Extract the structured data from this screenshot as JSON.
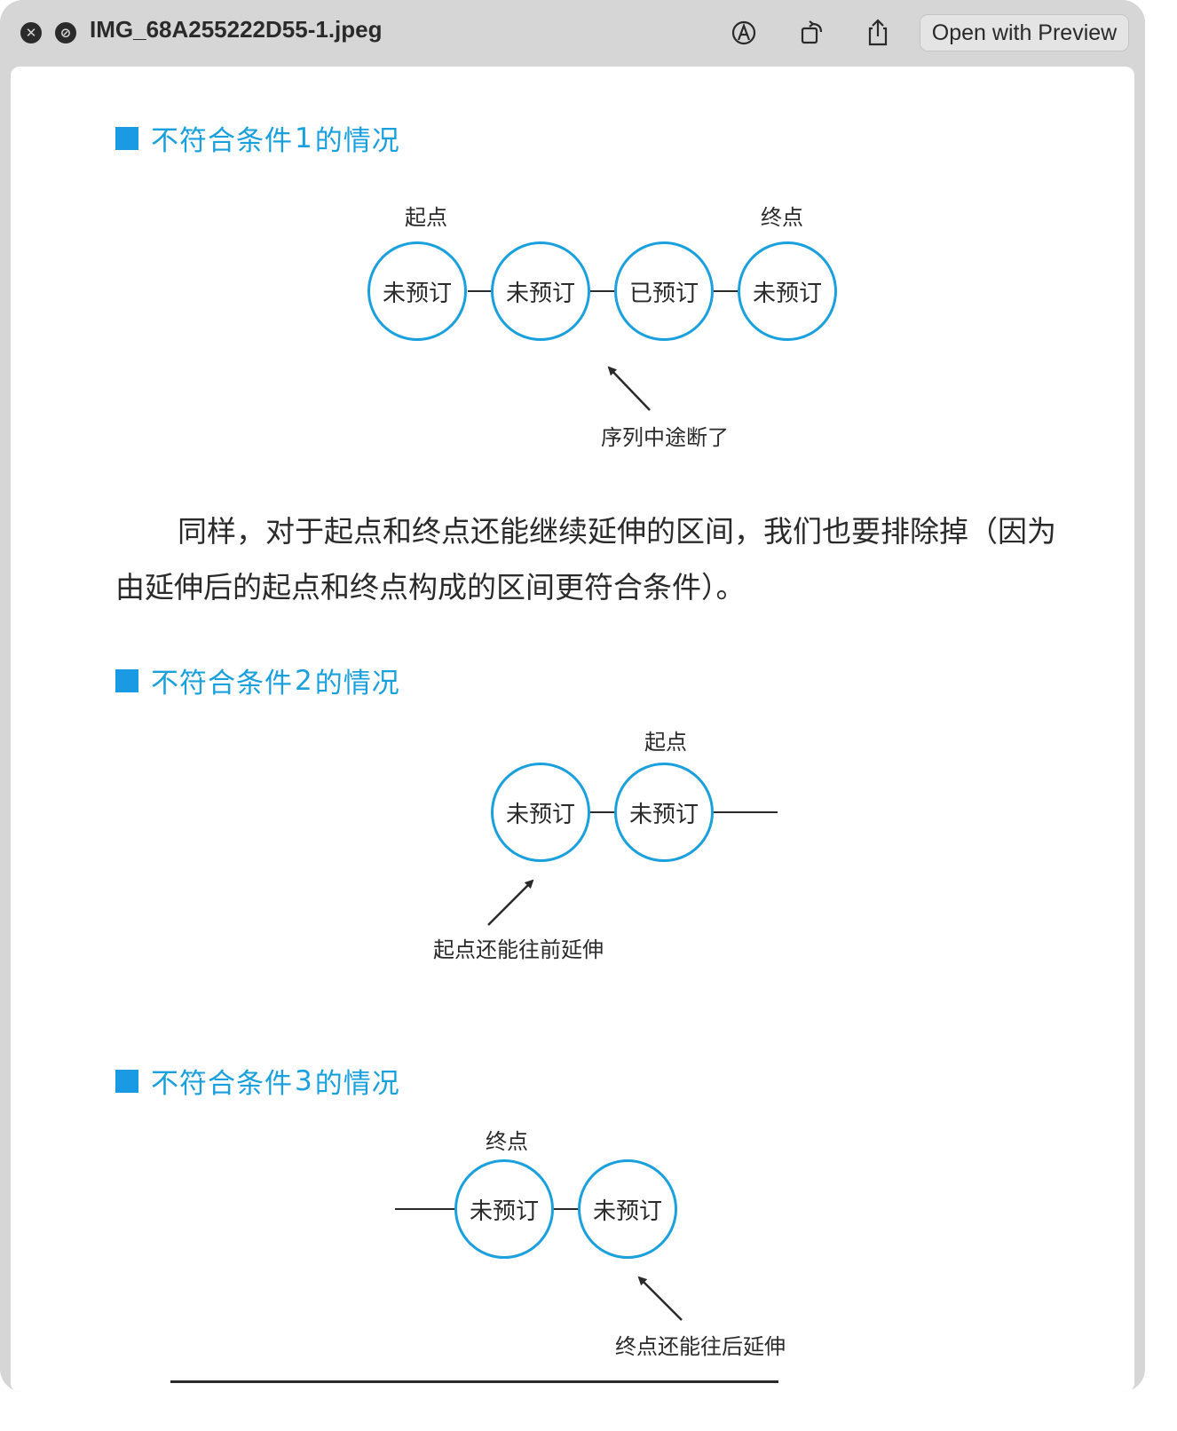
{
  "window": {
    "title": "IMG_68A255222D55-1.jpeg",
    "open_button": "Open with Preview",
    "toolbar_icons": [
      "close-icon",
      "hide-icon",
      "markup-icon",
      "rotate-icon",
      "share-icon"
    ]
  },
  "colors": {
    "accent": "#1aa0dd",
    "text": "#2a2a2a"
  },
  "sections": [
    {
      "heading": {
        "pre": "不符合条件",
        "num": "1",
        "post": "的情况"
      },
      "nodes": [
        "未预订",
        "未预订",
        "已预订",
        "未预订"
      ],
      "labels": {
        "start": "起点",
        "end": "终点",
        "note": "序列中途断了"
      }
    },
    {
      "heading": {
        "pre": "不符合条件",
        "num": "2",
        "post": "的情况"
      },
      "nodes": [
        "未预订",
        "未预订"
      ],
      "labels": {
        "start": "起点",
        "note": "起点还能往前延伸"
      }
    },
    {
      "heading": {
        "pre": "不符合条件",
        "num": "3",
        "post": "的情况"
      },
      "nodes": [
        "未预订",
        "未预订"
      ],
      "labels": {
        "end": "终点",
        "note": "终点还能往后延伸"
      }
    }
  ],
  "paragraph": {
    "line1": "同样，对于起点和终点还能继续延伸的区间，我们也要排除掉（因为",
    "line2": "由延伸后的起点和终点构成的区间更符合条件）。"
  }
}
